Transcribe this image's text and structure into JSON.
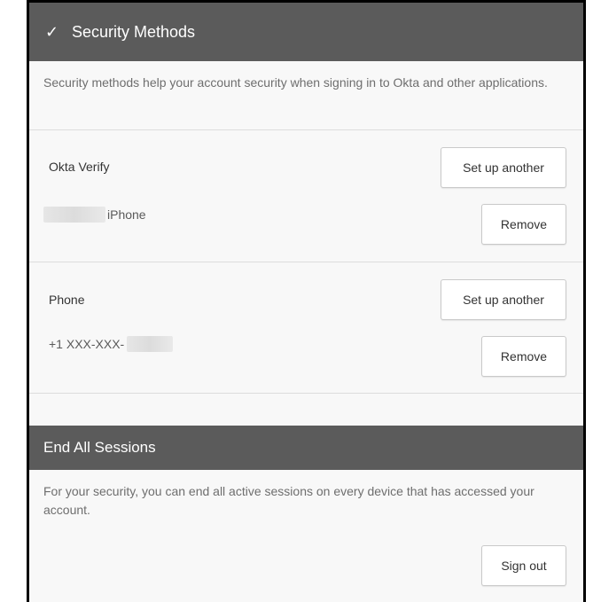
{
  "security_methods": {
    "title": "Security Methods",
    "check_glyph": "✓",
    "description": "Security methods help your account security when signing in to Okta and other applications.",
    "methods": [
      {
        "name": "Okta Verify",
        "device": "iPhone",
        "setup_label": "Set up another",
        "remove_label": "Remove"
      },
      {
        "name": "Phone",
        "device": "+1 XXX-XXX-",
        "setup_label": "Set up another",
        "remove_label": "Remove"
      }
    ]
  },
  "end_sessions": {
    "title": "End All Sessions",
    "description": "For your security, you can end all active sessions on every device that has accessed your account.",
    "signout_label": "Sign out"
  },
  "colors": {
    "header_bg": "#5b5b5b",
    "panel_bg": "#f8f8f8",
    "border": "#000000"
  }
}
